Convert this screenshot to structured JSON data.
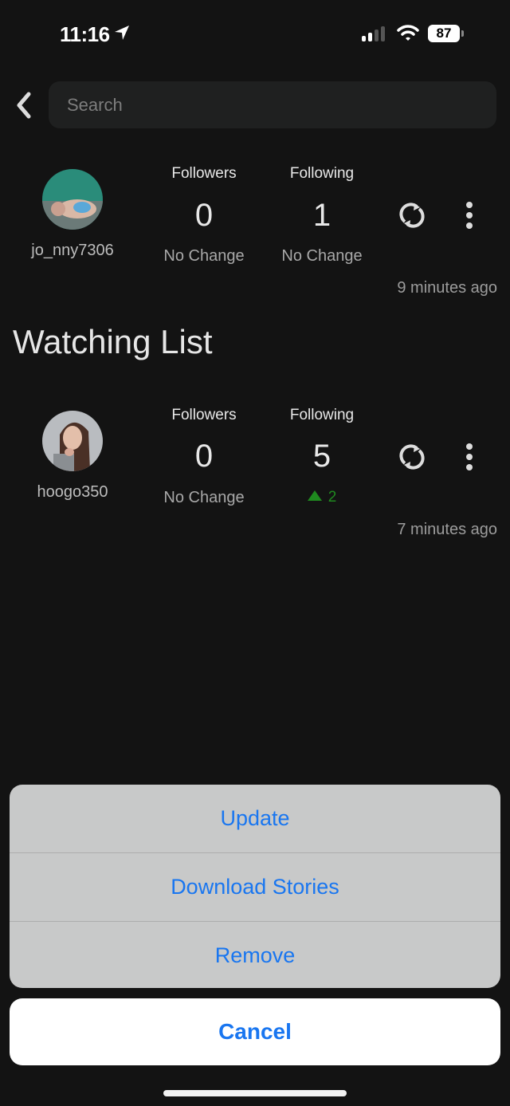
{
  "status_bar": {
    "time": "11:16",
    "battery": "87",
    "icons": [
      "location-arrow-icon",
      "cellular-signal-icon",
      "wifi-icon",
      "battery-icon"
    ]
  },
  "search": {
    "placeholder": "Search",
    "value": ""
  },
  "account": {
    "username": "jo_nny7306",
    "followers": {
      "label": "Followers",
      "value": "0",
      "change": "No Change"
    },
    "following": {
      "label": "Following",
      "value": "1",
      "change": "No Change"
    },
    "updated": "9 minutes ago"
  },
  "watching_list": {
    "title": "Watching List",
    "items": [
      {
        "username": "hoogo350",
        "followers": {
          "label": "Followers",
          "value": "0",
          "change": "No Change"
        },
        "following": {
          "label": "Following",
          "value": "5",
          "change": "2",
          "change_direction": "up"
        },
        "updated": "7 minutes ago"
      }
    ]
  },
  "action_sheet": {
    "items": [
      "Update",
      "Download Stories",
      "Remove"
    ],
    "cancel": "Cancel"
  },
  "colors": {
    "accent": "#1976f0",
    "increase": "#1f8a1f",
    "background": "#131313"
  }
}
